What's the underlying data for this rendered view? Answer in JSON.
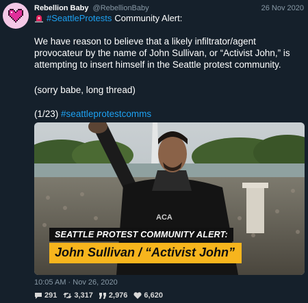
{
  "tweet": {
    "display_name": "Rebellion Baby",
    "handle": "@RebellionBaby",
    "date": "26 Nov 2020",
    "alert_hashtag": "#SeattleProtests",
    "alert_suffix": "Community Alert:",
    "body": "We have reason to believe that a likely infiltrator/agent provocateur by the name of John Sullivan, or “Activist John,” is attempting to insert himself in the Seattle protest community.",
    "sorry": "(sorry babe, long thread)",
    "thread_count": "(1/23)",
    "thread_hashtag": "#seattleprotestcomms",
    "timestamp": "10:05 AM · Nov 26, 2020"
  },
  "media": {
    "caption_top": "SEATTLE PROTEST COMMUNITY ALERT:",
    "caption_main": "John Sullivan / “Activist John”",
    "shirt_text": "ACA"
  },
  "stats": {
    "replies": "291",
    "retweets": "3,317",
    "quotes": "2,976",
    "likes": "6,620"
  },
  "icons": {
    "avatar": "pixel-heart-icon",
    "alert": "siren-icon",
    "replies": "reply-icon",
    "retweets": "retweet-icon",
    "quotes": "quote-icon",
    "likes": "heart-icon"
  },
  "colors": {
    "background": "#15202b",
    "link": "#1da1f2",
    "muted": "#8899a6",
    "caption_highlight": "#f7b51d"
  }
}
